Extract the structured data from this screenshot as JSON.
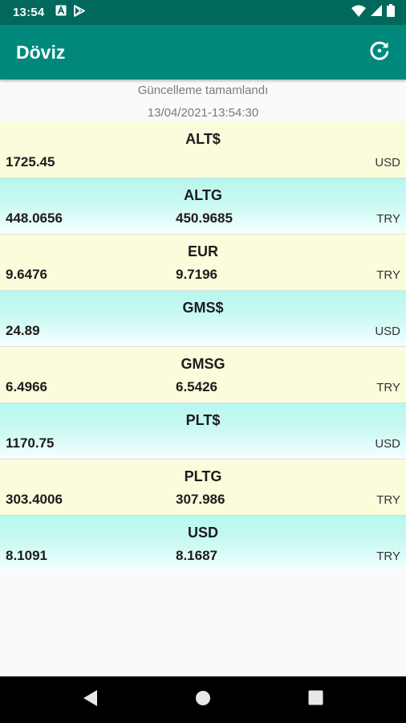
{
  "status_bar": {
    "time": "13:54",
    "left_icons": [
      "font-notification-icon",
      "play-store-icon"
    ],
    "right_icons": [
      "wifi-icon",
      "signal-icon",
      "battery-icon"
    ]
  },
  "app_bar": {
    "title": "Döviz",
    "refresh_icon": "refresh-icon",
    "color": "#00897b"
  },
  "update": {
    "status": "Güncelleme tamamlandı",
    "timestamp": "13/04/2021-13:54:30"
  },
  "colors": {
    "yellow_row": "#fbfcdc",
    "cyan_row": "#b7f7ef",
    "status_bar": "#00695c"
  },
  "rates": [
    {
      "code": "ALT$",
      "buy": "1725.45",
      "sell": "",
      "unit": "USD",
      "color": "yellow"
    },
    {
      "code": "ALTG",
      "buy": "448.0656",
      "sell": "450.9685",
      "unit": "TRY",
      "color": "cyan"
    },
    {
      "code": "EUR",
      "buy": "9.6476",
      "sell": "9.7196",
      "unit": "TRY",
      "color": "yellow"
    },
    {
      "code": "GMS$",
      "buy": "24.89",
      "sell": "",
      "unit": "USD",
      "color": "cyan"
    },
    {
      "code": "GMSG",
      "buy": "6.4966",
      "sell": "6.5426",
      "unit": "TRY",
      "color": "yellow"
    },
    {
      "code": "PLT$",
      "buy": "1170.75",
      "sell": "",
      "unit": "USD",
      "color": "cyan"
    },
    {
      "code": "PLTG",
      "buy": "303.4006",
      "sell": "307.986",
      "unit": "TRY",
      "color": "yellow"
    },
    {
      "code": "USD",
      "buy": "8.1091",
      "sell": "8.1687",
      "unit": "TRY",
      "color": "cyan"
    }
  ],
  "nav_bar": {
    "buttons": [
      "back-icon",
      "home-icon",
      "recents-icon"
    ]
  }
}
